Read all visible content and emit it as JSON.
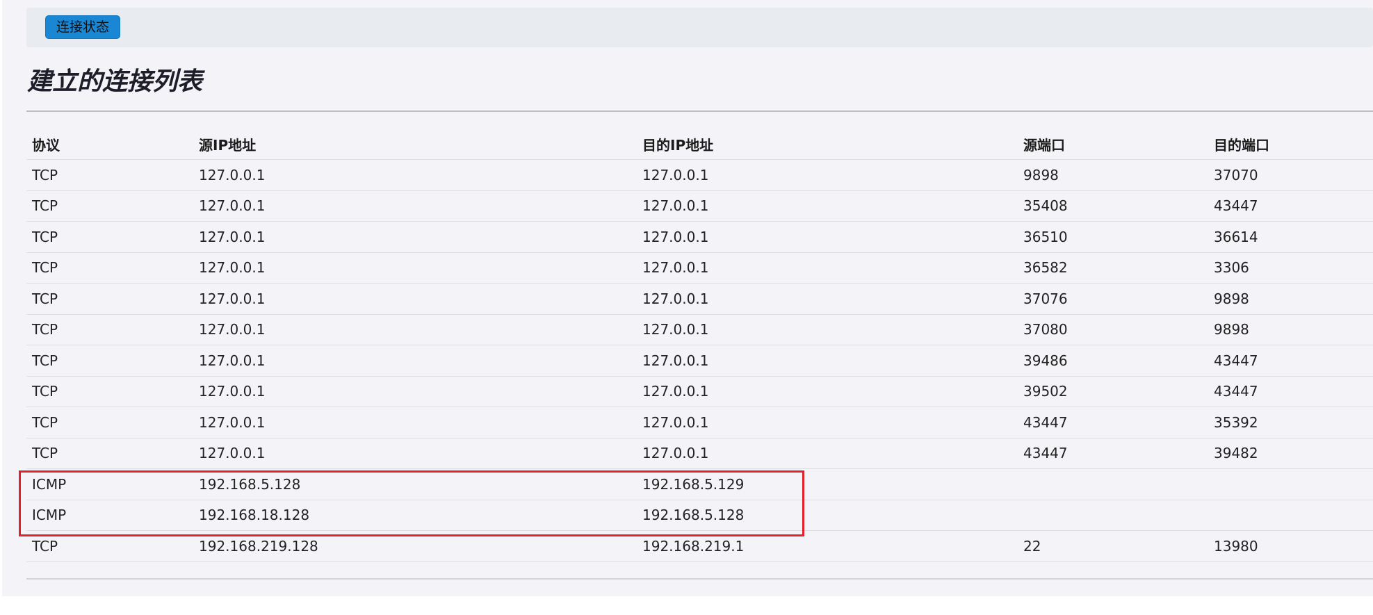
{
  "toolbar": {
    "status_button": "连接状态"
  },
  "page": {
    "title": "建立的连接列表"
  },
  "table": {
    "headers": {
      "protocol": "协议",
      "src_ip": "源IP地址",
      "dst_ip": "目的IP地址",
      "src_port": "源端口",
      "dst_port": "目的端口"
    },
    "rows": [
      {
        "protocol": "TCP",
        "src_ip": "127.0.0.1",
        "dst_ip": "127.0.0.1",
        "src_port": "9898",
        "dst_port": "37070"
      },
      {
        "protocol": "TCP",
        "src_ip": "127.0.0.1",
        "dst_ip": "127.0.0.1",
        "src_port": "35408",
        "dst_port": "43447"
      },
      {
        "protocol": "TCP",
        "src_ip": "127.0.0.1",
        "dst_ip": "127.0.0.1",
        "src_port": "36510",
        "dst_port": "36614"
      },
      {
        "protocol": "TCP",
        "src_ip": "127.0.0.1",
        "dst_ip": "127.0.0.1",
        "src_port": "36582",
        "dst_port": "3306"
      },
      {
        "protocol": "TCP",
        "src_ip": "127.0.0.1",
        "dst_ip": "127.0.0.1",
        "src_port": "37076",
        "dst_port": "9898"
      },
      {
        "protocol": "TCP",
        "src_ip": "127.0.0.1",
        "dst_ip": "127.0.0.1",
        "src_port": "37080",
        "dst_port": "9898"
      },
      {
        "protocol": "TCP",
        "src_ip": "127.0.0.1",
        "dst_ip": "127.0.0.1",
        "src_port": "39486",
        "dst_port": "43447"
      },
      {
        "protocol": "TCP",
        "src_ip": "127.0.0.1",
        "dst_ip": "127.0.0.1",
        "src_port": "39502",
        "dst_port": "43447"
      },
      {
        "protocol": "TCP",
        "src_ip": "127.0.0.1",
        "dst_ip": "127.0.0.1",
        "src_port": "43447",
        "dst_port": "35392"
      },
      {
        "protocol": "TCP",
        "src_ip": "127.0.0.1",
        "dst_ip": "127.0.0.1",
        "src_port": "43447",
        "dst_port": "39482"
      },
      {
        "protocol": "ICMP",
        "src_ip": "192.168.5.128",
        "dst_ip": "192.168.5.129",
        "src_port": "",
        "dst_port": ""
      },
      {
        "protocol": "ICMP",
        "src_ip": "192.168.18.128",
        "dst_ip": "192.168.5.128",
        "src_port": "",
        "dst_port": ""
      },
      {
        "protocol": "TCP",
        "src_ip": "192.168.219.128",
        "dst_ip": "192.168.219.1",
        "src_port": "22",
        "dst_port": "13980"
      }
    ]
  },
  "colors": {
    "accent": "#1a87d4",
    "highlight": "#e0232a"
  }
}
